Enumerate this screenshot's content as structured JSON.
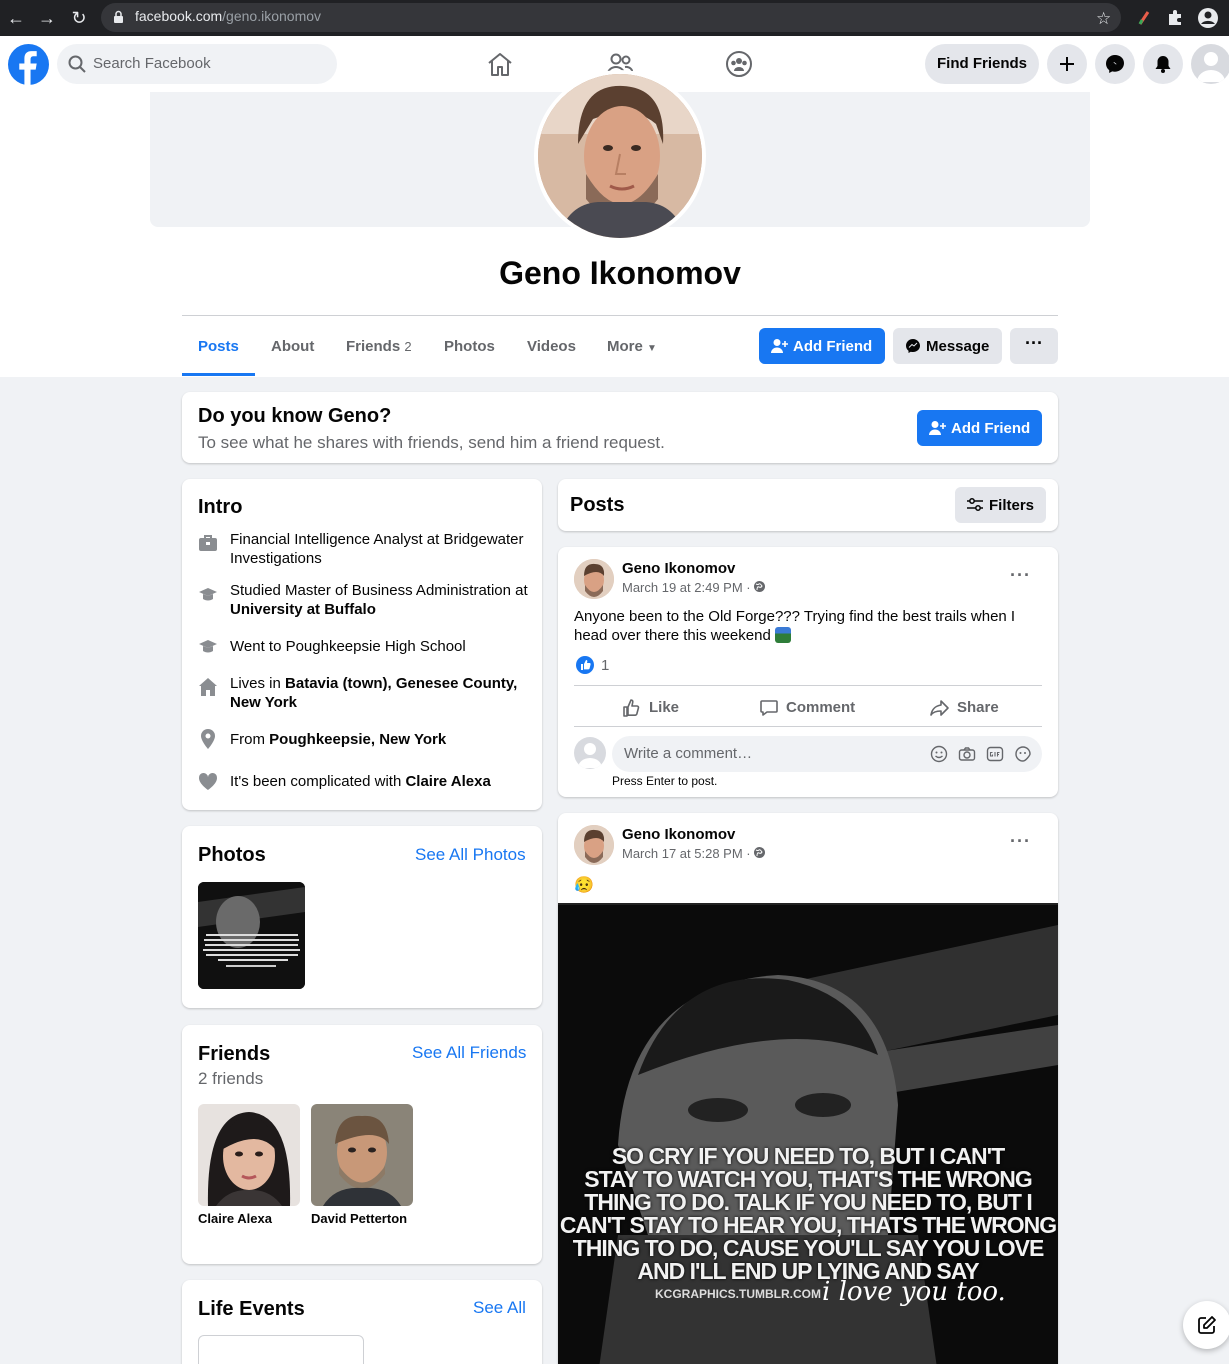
{
  "browser": {
    "url_domain": "facebook.com",
    "url_path": "/geno.ikonomov"
  },
  "header": {
    "search_placeholder": "Search Facebook",
    "find_friends_label": "Find Friends"
  },
  "profile": {
    "name": "Geno Ikonomov",
    "tabs": [
      "Posts",
      "About",
      "Friends",
      "Photos",
      "Videos",
      "More"
    ],
    "friends_count_badge": "2",
    "add_friend_label": "Add Friend",
    "message_label": "Message"
  },
  "know_card": {
    "title": "Do you know Geno?",
    "subtitle": "To see what he shares with friends, send him a friend request.",
    "button_label": "Add Friend"
  },
  "intro": {
    "title": "Intro",
    "items": [
      {
        "icon": "briefcase-icon",
        "prefix": "Financial Intelligence Analyst at Bridgewater Investigations",
        "bold": ""
      },
      {
        "icon": "graduation-cap-icon",
        "prefix": "Studied Master of Business Administration at ",
        "bold": "University at Buffalo"
      },
      {
        "icon": "graduation-cap-icon",
        "prefix": "Went to Poughkeepsie High School",
        "bold": ""
      },
      {
        "icon": "home-icon",
        "prefix": "Lives in ",
        "bold": "Batavia (town), Genesee County, New York"
      },
      {
        "icon": "location-pin-icon",
        "prefix": "From ",
        "bold": "Poughkeepsie, New York"
      },
      {
        "icon": "heart-icon",
        "prefix": "It's been complicated with ",
        "bold": "Claire Alexa"
      }
    ]
  },
  "photos_card": {
    "title": "Photos",
    "see_all": "See All Photos"
  },
  "friends_card": {
    "title": "Friends",
    "count_text": "2 friends",
    "see_all": "See All Friends",
    "friends": [
      {
        "name": "Claire Alexa"
      },
      {
        "name": "David Petterton"
      }
    ]
  },
  "life_events": {
    "title": "Life Events",
    "see_all": "See All"
  },
  "posts_header": {
    "title": "Posts",
    "filters_label": "Filters"
  },
  "posts": [
    {
      "author": "Geno Ikonomov",
      "time": "March 19 at 2:49 PM · ",
      "text": "Anyone been to the Old Forge??? Trying find the best trails when I head over there this weekend",
      "reactions": "1",
      "like": "Like",
      "comment": "Comment",
      "share": "Share",
      "comment_placeholder": "Write a comment…",
      "press_enter": "Press Enter to post."
    },
    {
      "author": "Geno Ikonomov",
      "time": "March 17 at 5:28 PM · ",
      "emoji": "😥",
      "image_lines": [
        "SO CRY IF YOU NEED TO, BUT I CAN'T",
        "STAY TO WATCH YOU, THAT'S THE WRONG",
        "THING TO DO. TALK IF YOU NEED TO, BUT I",
        "CAN'T STAY TO HEAR YOU, THATS THE WRONG",
        "THING TO DO, CAUSE YOU'LL SAY YOU LOVE",
        "AND I'LL END UP LYING AND SAY"
      ],
      "image_credit": "KCGRAPHICS.TUMBLR.COM",
      "image_script": "i love you too."
    }
  ],
  "colors": {
    "brand": "#1877f2",
    "page_bg": "#f0f2f5"
  }
}
